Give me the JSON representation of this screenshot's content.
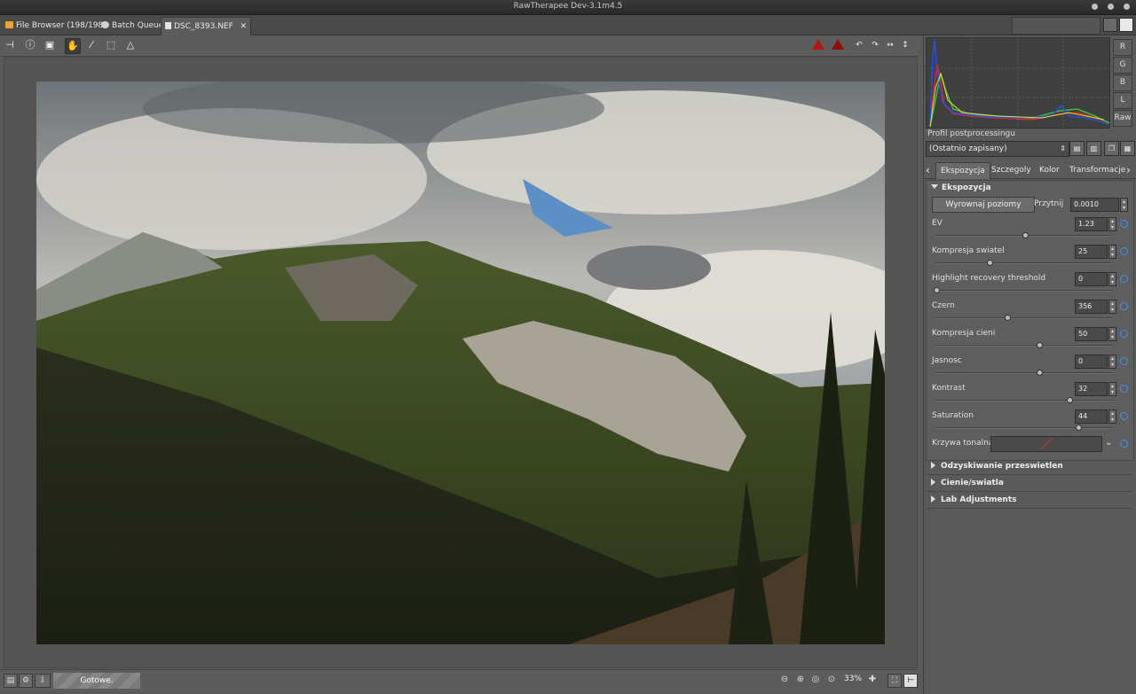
{
  "window": {
    "title": "RawTherapee Dev-3.1m4.5"
  },
  "tabs": [
    {
      "label": "File Browser  (198/198)"
    },
    {
      "label": "Batch Queue"
    },
    {
      "label": "DSC_8393.NEF"
    }
  ],
  "status": {
    "text": "Gotowe."
  },
  "zoom": {
    "value": "33%"
  },
  "panel": {
    "histogram_buttons": [
      "R",
      "G",
      "B",
      "L",
      "Raw"
    ],
    "profile_label": "Profil postprocessingu",
    "profile_value": "(Ostatnio zapisany)",
    "tabs": [
      "Ekspozycja",
      "Szczegoly",
      "Kolor",
      "Transformacje"
    ],
    "exposure": {
      "title": "Ekspozycja",
      "auto_levels_button": "Wyrownaj poziomy",
      "clip_label": "Przytnij",
      "clip_value": "0.0010",
      "params": [
        {
          "label": "EV",
          "value": "1.23",
          "pos": 0.5
        },
        {
          "label": "Kompresja swiatel",
          "value": "25",
          "pos": 0.3
        },
        {
          "label": "Highlight recovery threshold",
          "value": "0",
          "pos": 0.0
        },
        {
          "label": "Czern",
          "value": "356",
          "pos": 0.4
        },
        {
          "label": "Kompresja cieni",
          "value": "50",
          "pos": 0.58
        },
        {
          "label": "Jasnosc",
          "value": "0",
          "pos": 0.58
        },
        {
          "label": "Kontrast",
          "value": "32",
          "pos": 0.75
        },
        {
          "label": "Saturation",
          "value": "44",
          "pos": 0.8
        }
      ],
      "curve_label": "Krzywa tonalna:"
    },
    "collapsed_sections": [
      "Odzyskiwanie przeswietlen",
      "Cienie/swiatla",
      "Lab Adjustments"
    ]
  }
}
